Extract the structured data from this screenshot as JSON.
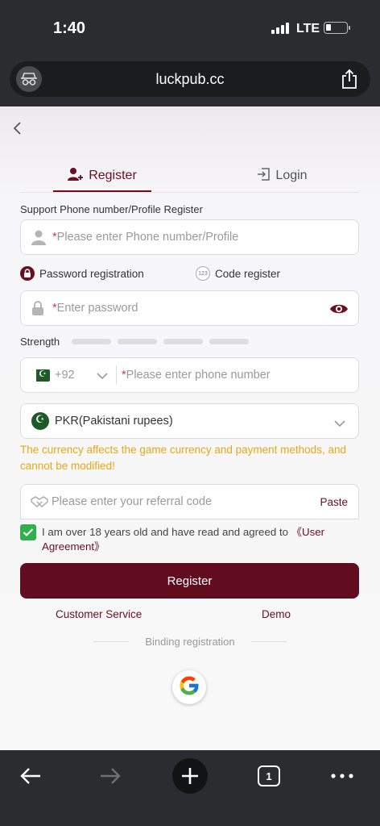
{
  "status_bar": {
    "time": "1:40",
    "network": "LTE"
  },
  "browser": {
    "url": "luckpub.cc"
  },
  "tabs": {
    "register": "Register",
    "login": "Login"
  },
  "form": {
    "support_label": "Support Phone number/Profile Register",
    "profile_placeholder": "Please enter Phone number/Profile",
    "password_registration": "Password registration",
    "code_register": "Code register",
    "password_placeholder": "Enter password",
    "strength_label": "Strength",
    "country_code": "+92",
    "phone_placeholder": "Please enter phone number",
    "currency": "PKR(Pakistani rupees)",
    "currency_note": "The currency affects the game currency and payment methods, and cannot be modified!",
    "referral_placeholder": "Please enter your referral code",
    "paste_label": "Paste",
    "agreement_text": "I am over 18 years old and have read and agreed to ",
    "agreement_link": "《User Agreement》",
    "agreement_checked": true,
    "register_button": "Register"
  },
  "links": {
    "customer_service": "Customer Service",
    "demo": "Demo"
  },
  "binding": {
    "label": "Binding registration"
  },
  "toolbar": {
    "tab_count": "1"
  },
  "colors": {
    "brand": "#620c20",
    "warning": "#e9a617",
    "check": "#2fb04a"
  }
}
